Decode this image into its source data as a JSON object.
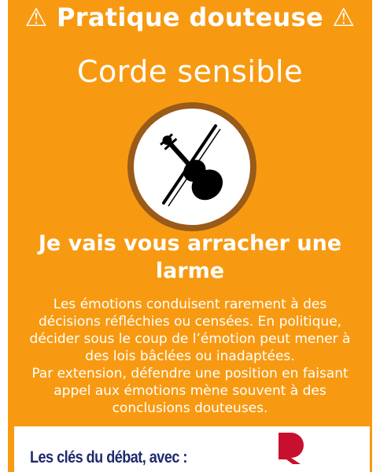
{
  "header": {
    "title": "⚠ Pratique douteuse ⚠"
  },
  "subtitle": "Corde sensible",
  "illustration": {
    "icon": "violin-with-bow-icon",
    "ring_color": "#9a5a18"
  },
  "headline": "Je vais vous arracher une larme",
  "body": {
    "paragraph_1": "Les émotions conduisent rarement à des décisions réfléchies ou censées. En politique, décider sous le coup de l’émotion peut mener à des lois bâclées ou inadaptées.",
    "paragraph_2": "Par extension, défendre une position en faisant appel aux émotions mène souvent à des conclusions douteuses."
  },
  "footer": {
    "label": "Les clés du débat, avec :",
    "logo_icon": "brand-logo-icon",
    "logo_color": "#c8102e",
    "label_color": "#1e2a6e"
  },
  "colors": {
    "background": "#f79a12",
    "text": "#ffffff"
  }
}
